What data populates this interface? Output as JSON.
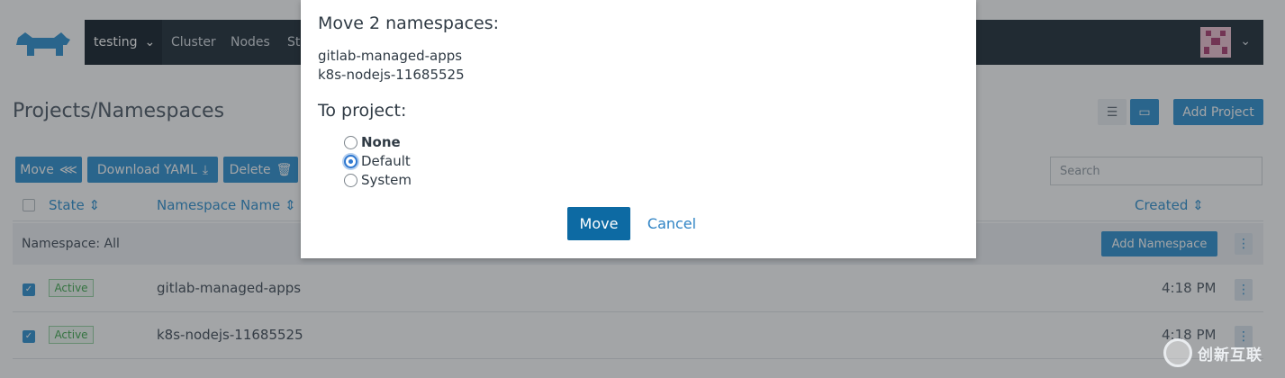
{
  "topbar": {
    "cluster": "testing",
    "nav": [
      "Cluster",
      "Nodes",
      "St"
    ]
  },
  "page": {
    "title": "Projects/Namespaces",
    "add_project": "Add Project"
  },
  "actions": {
    "move": "Move",
    "download_yaml": "Download YAML",
    "delete": "Delete",
    "search_placeholder": "Search"
  },
  "table": {
    "columns": {
      "state": "State",
      "namespace_name": "Namespace Name",
      "created": "Created"
    },
    "group_label": "Namespace: All",
    "add_namespace": "Add Namespace",
    "rows": [
      {
        "state": "Active",
        "name": "gitlab-managed-apps",
        "created": "4:18 PM",
        "checked": true
      },
      {
        "state": "Active",
        "name": "k8s-nodejs-11685525",
        "created": "4:18 PM",
        "checked": true
      }
    ]
  },
  "modal": {
    "title": "Move 2 namespaces:",
    "namespaces": [
      "gitlab-managed-apps",
      "k8s-nodejs-11685525"
    ],
    "project_label": "To project:",
    "options": [
      {
        "label": "None",
        "selected": false,
        "bold": true
      },
      {
        "label": "Default",
        "selected": true,
        "bold": false
      },
      {
        "label": "System",
        "selected": false,
        "bold": false
      }
    ],
    "move_button": "Move",
    "cancel_button": "Cancel"
  },
  "watermark": {
    "text": "创新互联"
  },
  "colors": {
    "primary": "#3d98d3",
    "modal_primary": "#0d6aa3",
    "topbar": "#2e3a45",
    "active_green": "#4cae5a"
  }
}
